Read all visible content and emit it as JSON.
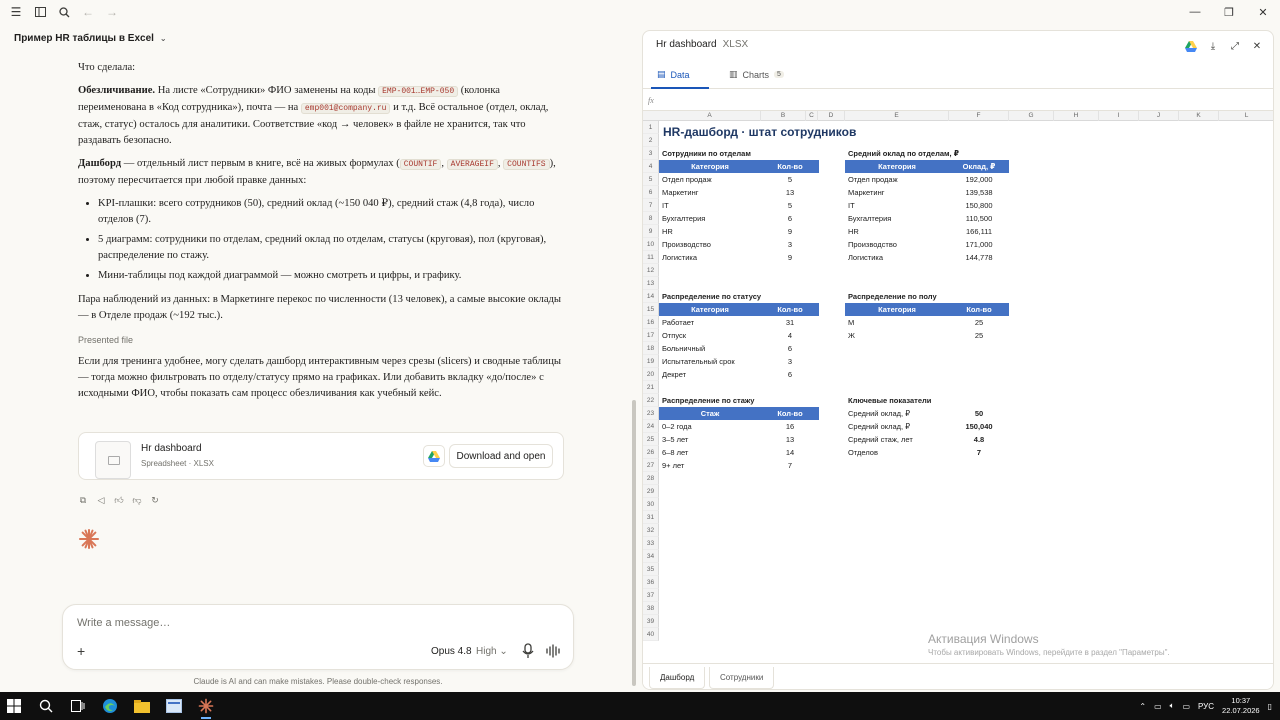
{
  "chat": {
    "title": "Пример HR таблицы в Excel",
    "intro": "Что сделала:",
    "p1_bold": "Обезличивание.",
    "p1_a": " На листе «Сотрудники» ФИО заменены на коды ",
    "p1_code1": "EMP-001…EMP-050",
    "p1_b": " (колонка переименована в «Код сотрудника»), почта — на ",
    "p1_code2": "emp001@company.ru",
    "p1_c": " и т.д. Всё остальное (отдел, оклад, стаж, статус) осталось для аналитики. Соответствие «код → человек» в файле не хранится, так что раздавать безопасно.",
    "p2_bold": "Дашборд",
    "p2_a": " — отдельный лист первым в книге, всё на живых формулах (",
    "p2_code1": "COUNTIF",
    "p2_sep1": ", ",
    "p2_code2": "AVERAGEIF",
    "p2_sep2": ", ",
    "p2_code3": "COUNTIFS",
    "p2_b": "), поэтому пересчитается при любой правке данных:",
    "bullets": [
      "KPI-плашки: всего сотрудников (50), средний оклад (~150 040 ₽), средний стаж (4,8 года), число отделов (7).",
      "5 диаграмм: сотрудники по отделам, средний оклад по отделам, статусы (круговая), пол (круговая), распределение по стажу.",
      "Мини-таблицы под каждой диаграммой — можно смотреть и цифры, и графику."
    ],
    "p3": "Пара наблюдений из данных: в Маркетинге перекос по численности (13 человек), а самые высокие оклады — в Отделе продаж (~192 тыс.).",
    "presented": "Presented file",
    "p4": "Если для тренинга удобнее, могу сделать дашборд интерактивным через срезы (slicers) и сводные таблицы — тогда можно фильтровать по отделу/статусу прямо на графиках. Или добавить вкладку «до/после» с исходными ФИО, чтобы показать сам процесс обезличивания как учебный кейс.",
    "file_name": "Hr dashboard",
    "file_meta": "Spreadsheet · XLSX",
    "download_label": "Download and open"
  },
  "composer": {
    "placeholder": "Write a message…",
    "model": "Opus 4.8",
    "effort": "High",
    "disclaimer": "Claude is AI and can make mistakes. Please double-check responses."
  },
  "artifact": {
    "title": "Hr dashboard",
    "type": "XLSX",
    "tab_data": "Data",
    "tab_charts": "Charts",
    "charts_count": "5",
    "fx": "fx",
    "columns": [
      "A",
      "B",
      "C",
      "D",
      "E",
      "F",
      "G",
      "H",
      "I",
      "J",
      "K",
      "L"
    ],
    "sheet_title": "HR-дашборд · штат сотрудников",
    "dept": {
      "title": "Сотрудники по отделам",
      "h1": "Категория",
      "h2": "Кол-во",
      "rows": [
        [
          "Отдел продаж",
          "5"
        ],
        [
          "Маркетинг",
          "13"
        ],
        [
          "IT",
          "5"
        ],
        [
          "Бухгалтерия",
          "6"
        ],
        [
          "HR",
          "9"
        ],
        [
          "Производство",
          "3"
        ],
        [
          "Логистика",
          "9"
        ]
      ]
    },
    "salary": {
      "title": "Средний оклад по отделам, ₽",
      "h1": "Категория",
      "h2": "Оклад, ₽",
      "rows": [
        [
          "Отдел продаж",
          "192,000"
        ],
        [
          "Маркетинг",
          "139,538"
        ],
        [
          "IT",
          "150,800"
        ],
        [
          "Бухгалтерия",
          "110,500"
        ],
        [
          "HR",
          "166,111"
        ],
        [
          "Производство",
          "171,000"
        ],
        [
          "Логистика",
          "144,778"
        ]
      ]
    },
    "status": {
      "title": "Распределение по статусу",
      "h1": "Категория",
      "h2": "Кол-во",
      "rows": [
        [
          "Работает",
          "31"
        ],
        [
          "Отпуск",
          "4"
        ],
        [
          "Больничный",
          "6"
        ],
        [
          "Испытательный срок",
          "3"
        ],
        [
          "Декрет",
          "6"
        ]
      ]
    },
    "gender": {
      "title": "Распределение по полу",
      "h1": "Категория",
      "h2": "Кол-во",
      "rows": [
        [
          "М",
          "25"
        ],
        [
          "Ж",
          "25"
        ]
      ]
    },
    "tenure": {
      "title": "Распределение по стажу",
      "h1": "Стаж",
      "h2": "Кол-во",
      "rows": [
        [
          "0–2 года",
          "16"
        ],
        [
          "3–5 лет",
          "13"
        ],
        [
          "6–8 лет",
          "14"
        ],
        [
          "9+ лет",
          "7"
        ]
      ]
    },
    "kpi": {
      "title": "Ключевые показатели",
      "rows": [
        [
          "Средний оклад, ₽",
          "50"
        ],
        [
          "Средний оклад, ₽",
          "150,040"
        ],
        [
          "Средний стаж, лет",
          "4.8"
        ],
        [
          "Отделов",
          "7"
        ]
      ]
    },
    "sheet_tabs": [
      "Дашборд",
      "Сотрудники"
    ]
  },
  "watermark": {
    "line1": "Активация Windows",
    "line2": "Чтобы активировать Windows, перейдите в раздел \"Параметры\"."
  },
  "tray": {
    "lang": "РУС",
    "time": "10:37",
    "date": "22.07.2026"
  }
}
